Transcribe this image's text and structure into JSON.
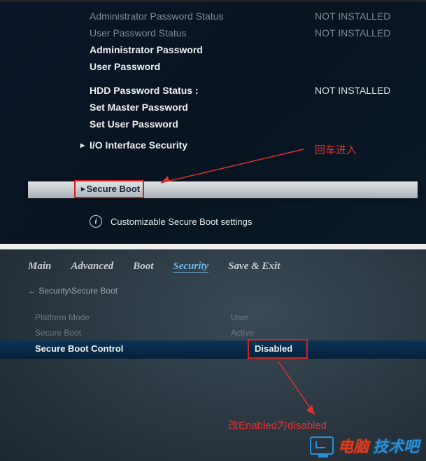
{
  "top": {
    "rows": [
      {
        "label": "Administrator Password Status",
        "value": "NOT INSTALLED"
      },
      {
        "label": "User Password Status",
        "value": "NOT INSTALLED"
      },
      {
        "label": "Administrator Password",
        "value": ""
      },
      {
        "label": "User Password",
        "value": ""
      },
      {
        "label": "HDD Password Status :",
        "value": "NOT INSTALLED"
      },
      {
        "label": "Set Master Password",
        "value": ""
      },
      {
        "label": "Set User Password",
        "value": ""
      }
    ],
    "submenu": "I/O Interface Security",
    "selected": "Secure Boot",
    "hint": "Customizable Secure Boot settings",
    "annotation": "回车进入"
  },
  "bottom": {
    "tabs": [
      "Main",
      "Advanced",
      "Boot",
      "Security",
      "Save & Exit"
    ],
    "active_tab": "Security",
    "breadcrumb": "← Security\\Secure Boot",
    "rows": [
      {
        "label": "Platform Mode",
        "value": "User"
      },
      {
        "label": "Secure Boot",
        "value": "Active"
      }
    ],
    "selected_label": "Secure Boot Control",
    "selected_value": "Disabled",
    "annotation": "改Enabled为disabled",
    "watermark": {
      "part1": "电脑",
      "part2": "技术吧"
    }
  }
}
